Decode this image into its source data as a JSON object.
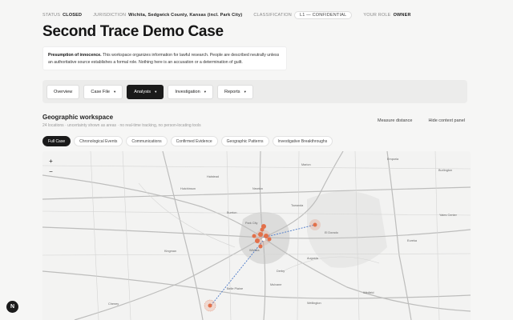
{
  "meta": {
    "status_label": "STATUS",
    "status_value": "CLOSED",
    "jurisdiction_label": "JURISDICTION",
    "jurisdiction_value": "Wichita, Sedgwick County, Kansas (incl. Park City)",
    "classification_label": "CLASSIFICATION",
    "classification_value": "L1 — CONFIDENTIAL",
    "role_label": "YOUR ROLE",
    "role_value": "OWNER"
  },
  "page": {
    "title": "Second Trace Demo Case"
  },
  "notice": {
    "bold": "Presumption of innocence.",
    "text": " This workspace organizes information for lawful research. People are described neutrally unless an authoritative source establishes a formal role. Nothing here is an accusation or a determination of guilt."
  },
  "nav": {
    "overview": "Overview",
    "case_file": "Case File",
    "analysis": "Analysis",
    "investigation": "Investigation",
    "reports": "Reports"
  },
  "geo": {
    "title": "Geographic workspace",
    "subtitle": "24 locations · uncertainty shown as areas · no real-time tracking, no person-locating tools",
    "measure": "Measure distance",
    "hide_panel": "Hide context panel"
  },
  "filters": [
    "Full Case",
    "Chronological Events",
    "Communications",
    "Confirmed Evidence",
    "Geographic Patterns",
    "Investigative Breakthroughs"
  ],
  "map": {
    "zoom_in": "+",
    "zoom_out": "−",
    "labels": {
      "hutchinson": "Hutchinson",
      "newton": "Newton",
      "kingman": "Kingman",
      "wellington": "Wellington",
      "el_dorado": "El Dorado",
      "wichita": "Wichita",
      "augusta": "Augusta",
      "winfield": "Winfield",
      "eureka": "Eureka",
      "park_city": "Park City",
      "derby": "Derby",
      "mulvane": "Mulvane",
      "marion": "Marion",
      "towanda": "Towanda",
      "burrton": "Burrton",
      "yates_center": "Yates Center",
      "burlington": "Burlington",
      "emporia": "Emporia",
      "belle_plaine": "Belle Plaine",
      "cheney": "Cheney",
      "halstead": "Halstead"
    },
    "colors": {
      "marker": "#e2704a",
      "route": "#4a78c8"
    }
  },
  "fab": {
    "glyph": "N"
  }
}
